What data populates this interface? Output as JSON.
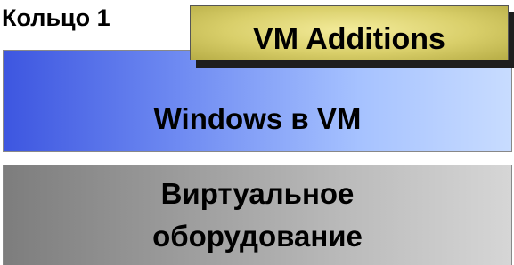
{
  "diagram": {
    "ring_label": "Кольцо 1",
    "additions_label": "VM Additions",
    "guest_os_label": "Windows в VM",
    "hardware_label_line1": "Виртуальное",
    "hardware_label_line2": "оборудование"
  },
  "colors": {
    "guest_os_box": "#6f8bf2",
    "hardware_box": "#9c9c9c",
    "additions_box": "#d9cf6a"
  }
}
